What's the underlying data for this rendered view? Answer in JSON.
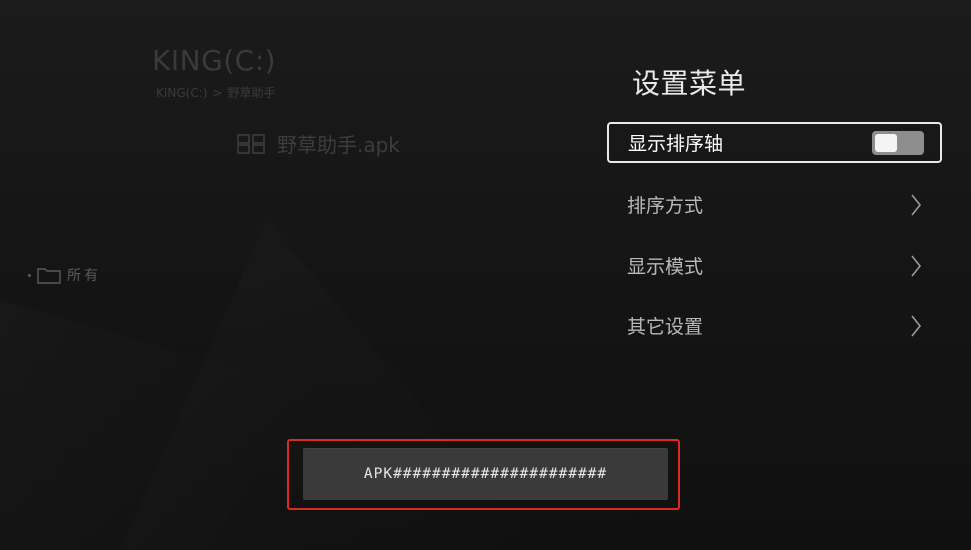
{
  "header": {
    "title": "KING(C:)",
    "breadcrumb": {
      "root": "KING(C:)",
      "separator": ">",
      "current": "野草助手"
    }
  },
  "file_list": {
    "items": [
      {
        "icon": "grid-icon",
        "name": "野草助手.apk"
      }
    ]
  },
  "sidebar": {
    "items": [
      {
        "icon": "folder-icon",
        "label": "所有"
      }
    ]
  },
  "settings_menu": {
    "title": "设置菜单",
    "items": [
      {
        "label": "显示排序轴",
        "control": "toggle",
        "toggle_on": false
      },
      {
        "label": "排序方式",
        "control": "chevron-right-icon"
      },
      {
        "label": "显示模式",
        "control": "chevron-right-icon"
      },
      {
        "label": "其它设置",
        "control": "chevron-right-icon"
      }
    ]
  },
  "footer": {
    "apk_button_label": "APK######################"
  },
  "colors": {
    "background": "#151515",
    "focus_border": "#e9e9e9",
    "highlight_border": "#d92b22",
    "button_bg": "#3a3a3a"
  }
}
